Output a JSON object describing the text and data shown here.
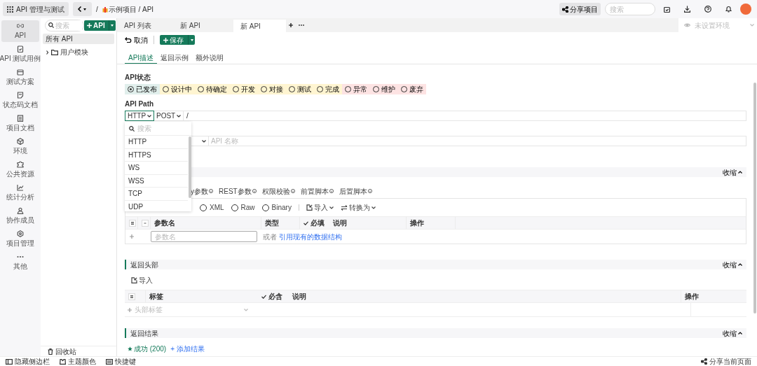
{
  "app_bar": {
    "app_button": "API 管理与测试",
    "breadcrumb_lead": "/",
    "breadcrumb": "示例项目 / API",
    "share_button": "分享项目",
    "search": {
      "placeholder": "搜索"
    }
  },
  "nav_rail": [
    {
      "label": "API",
      "selected": true
    },
    {
      "label": "API 测试用例",
      "selected": false
    },
    {
      "label": "测试方案",
      "selected": false
    },
    {
      "label": "状态码文档",
      "selected": false
    },
    {
      "label": "项目文档",
      "selected": false
    },
    {
      "label": "环境",
      "selected": false
    },
    {
      "label": "公共资源",
      "selected": false
    },
    {
      "label": "统计分析",
      "selected": false
    },
    {
      "label": "协作成员",
      "selected": false
    },
    {
      "label": "项目管理",
      "selected": false
    },
    {
      "label": "其他",
      "selected": false
    }
  ],
  "tree": {
    "search": {
      "placeholder": "搜索"
    },
    "add_button": "API",
    "items": [
      {
        "kind": "all",
        "label": "所有 API",
        "selected": true
      },
      {
        "kind": "folder",
        "label": "用户模块",
        "selected": false,
        "expanded": false
      }
    ],
    "recycle": "回收站"
  },
  "tabs": [
    {
      "label": "API 列表",
      "selected": false
    },
    {
      "label": "新 API",
      "selected": false
    },
    {
      "label": "新 API",
      "selected": true
    }
  ],
  "environment": {
    "placeholder": "未设置环境"
  },
  "toolbar": {
    "cancel": "取消",
    "save": "保存"
  },
  "sub_tabs": [
    {
      "label": "API描述",
      "selected": true
    },
    {
      "label": "返回示例",
      "selected": false
    },
    {
      "label": "额外说明",
      "selected": false
    }
  ],
  "status": {
    "label": "API状态",
    "options": [
      {
        "label": "已发布",
        "selected": true,
        "color": "#e1efec"
      },
      {
        "label": "设计中",
        "selected": false,
        "color": "#fff5d1"
      },
      {
        "label": "待确定",
        "selected": false,
        "color": "#fff5d1"
      },
      {
        "label": "开发",
        "selected": false,
        "color": "#fff5d1"
      },
      {
        "label": "对接",
        "selected": false,
        "color": "#fff5d1"
      },
      {
        "label": "测试",
        "selected": false,
        "color": "#fff5d1"
      },
      {
        "label": "完成",
        "selected": false,
        "color": "#fff5d1"
      },
      {
        "label": "异常",
        "selected": false,
        "color": "#fde3e3"
      },
      {
        "label": "维护",
        "selected": false,
        "color": "#fde3e3"
      },
      {
        "label": "废弃",
        "selected": false,
        "color": "#fde3e3"
      }
    ]
  },
  "path": {
    "label": "API Path",
    "protocol": "HTTP",
    "method": "POST",
    "value": "/"
  },
  "protocol_menu": {
    "search": {
      "placeholder": "搜索"
    },
    "options": [
      "HTTP",
      "HTTPS",
      "WS",
      "WSS",
      "TCP",
      "UDP"
    ]
  },
  "name_row": {
    "placeholder": "API 名称"
  },
  "request": {
    "collapse": "收缩",
    "tabs": [
      "y参数",
      "REST参数",
      "权限校验",
      "前置脚本",
      "后置脚本"
    ],
    "body_types": [
      {
        "label": "XML",
        "selected": false
      },
      {
        "label": "Raw",
        "selected": false
      },
      {
        "label": "Binary",
        "selected": false
      }
    ],
    "import": "导入",
    "convert": "转换为",
    "columns": [
      "参数名",
      "类型",
      "必填",
      "说明",
      "操作"
    ],
    "placeholder": "参数名",
    "hint": "或者",
    "link": "引用现有的数据结构"
  },
  "response_headers": {
    "title": "返回头部",
    "collapse": "收缩",
    "import": "导入",
    "columns": [
      "标签",
      "必含",
      "说明",
      "操作"
    ],
    "placeholder": "头部标签"
  },
  "response_results": {
    "title": "返回结果",
    "collapse": "收缩",
    "results": [
      "成功 (200)"
    ],
    "add": "+ 添加结果"
  },
  "footer": {
    "items": [
      "隐藏侧边栏",
      "主题颜色",
      "快捷键"
    ],
    "share": "分享当前页面"
  }
}
